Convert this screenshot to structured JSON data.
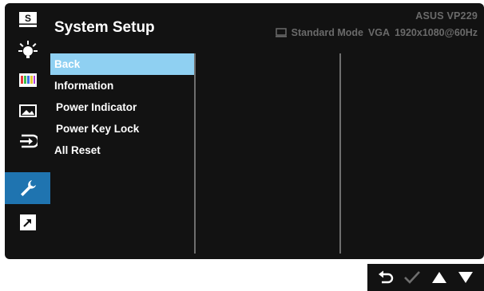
{
  "header": {
    "title": "System Setup",
    "model": "ASUS  VP229",
    "status": {
      "mode": "Standard Mode",
      "input": "VGA",
      "resolution": "1920x1080@60Hz"
    }
  },
  "sidebar": {
    "items": [
      {
        "name": "splendid",
        "icon": "s-letter-icon"
      },
      {
        "name": "brightness",
        "icon": "brightness-icon"
      },
      {
        "name": "color",
        "icon": "color-bars-icon"
      },
      {
        "name": "image",
        "icon": "image-icon"
      },
      {
        "name": "input-select",
        "icon": "input-select-icon"
      },
      {
        "name": "system-setup",
        "icon": "wrench-icon",
        "active": true
      },
      {
        "name": "shortcut",
        "icon": "shortcut-arrow-icon"
      }
    ]
  },
  "menu": {
    "items": [
      {
        "label": "Back",
        "selected": true
      },
      {
        "label": "Information"
      },
      {
        "label": "Power Indicator"
      },
      {
        "label": "Power Key Lock"
      },
      {
        "label": "All Reset"
      }
    ]
  },
  "nav_buttons": [
    {
      "name": "return-button",
      "icon": "return-arrow-icon"
    },
    {
      "name": "confirm-button",
      "icon": "checkmark-icon"
    },
    {
      "name": "up-button",
      "icon": "triangle-up-icon"
    },
    {
      "name": "down-button",
      "icon": "triangle-down-icon"
    }
  ],
  "colors": {
    "panel": "#121212",
    "active_sidebar": "#1f74b0",
    "selected_item": "#8fd0f2",
    "status_text": "#6a6a6a"
  }
}
